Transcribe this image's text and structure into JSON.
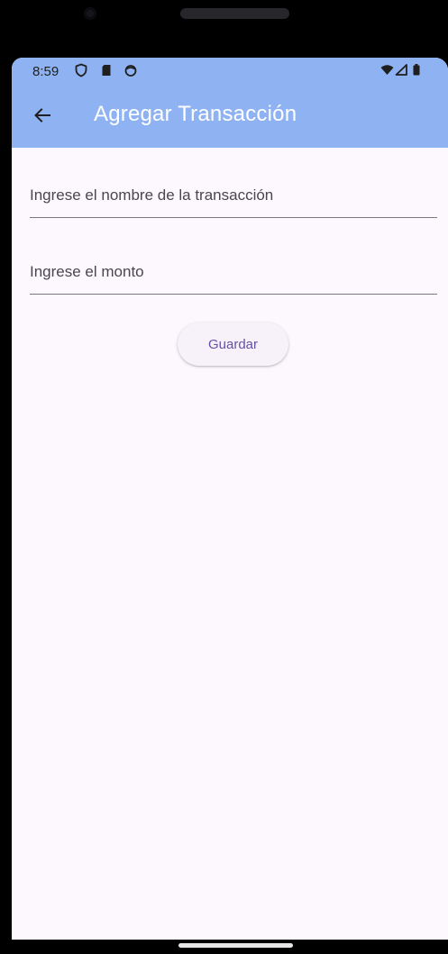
{
  "status_bar": {
    "time": "8:59",
    "left_icons": [
      "shield-icon",
      "sd-card-icon",
      "notification-circle-icon"
    ],
    "right_icons": [
      "wifi-icon",
      "signal-icon",
      "battery-icon"
    ]
  },
  "app_bar": {
    "title": "Agregar Transacción",
    "back_icon": "arrow-back-icon",
    "background": "#8fb3f2",
    "title_color": "#ffffff"
  },
  "form": {
    "name_field": {
      "placeholder": "Ingrese el nombre de la transacción",
      "value": ""
    },
    "amount_field": {
      "placeholder": "Ingrese el monto",
      "value": ""
    },
    "save_label": "Guardar"
  },
  "colors": {
    "screen_background": "#fdf8fd",
    "button_text": "#6750a4",
    "underline": "#7a757f"
  }
}
